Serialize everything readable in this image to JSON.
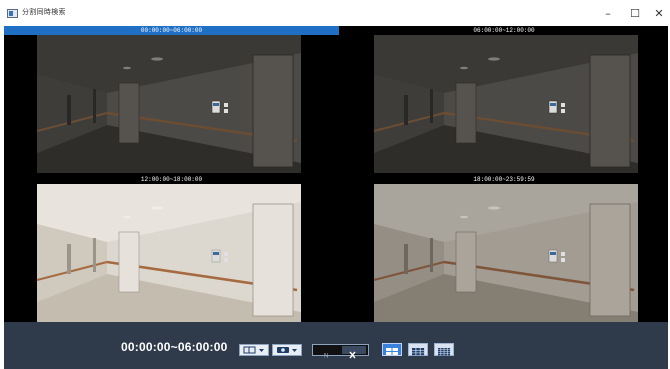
{
  "window": {
    "title": "分割同時検索",
    "controls": {
      "minimize": "–",
      "maximize": "☐",
      "close": "✕"
    }
  },
  "panes": [
    {
      "label": "00:00:00~06:00:00",
      "selected": true,
      "lighting": "dark"
    },
    {
      "label": "06:00:00~12:00:00",
      "selected": false,
      "lighting": "dark"
    },
    {
      "label": "12:00:00~18:00:00",
      "selected": false,
      "lighting": "bright"
    },
    {
      "label": "18:00:00~23:59:59",
      "selected": false,
      "lighting": "dim"
    }
  ],
  "controls": {
    "time_range": "00:00:00~06:00:00",
    "layout_options": [
      {
        "name": "2x2",
        "active": true
      },
      {
        "name": "3x3",
        "active": false
      },
      {
        "name": "4x4",
        "active": false
      }
    ]
  },
  "colors": {
    "selected_header": "#1f6fc4",
    "control_bar": "#2f3a4a"
  }
}
